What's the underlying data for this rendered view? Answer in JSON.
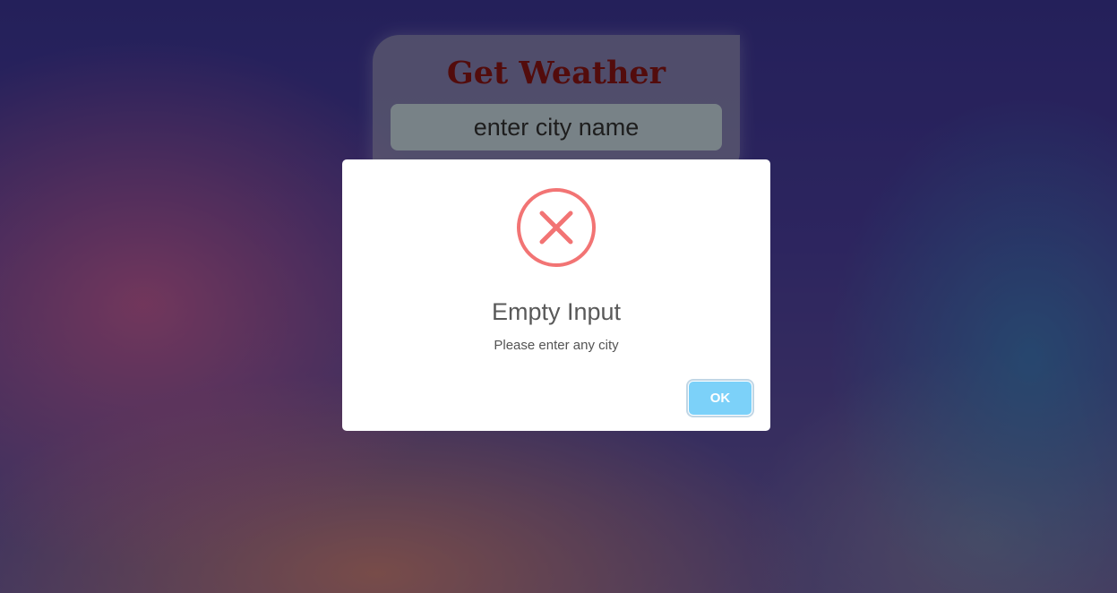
{
  "weather": {
    "title": "Get Weather",
    "input_placeholder": "enter city name",
    "input_value": ""
  },
  "dialog": {
    "icon": "error-x-icon",
    "title": "Empty Input",
    "text": "Please enter any city",
    "ok_label": "OK"
  },
  "colors": {
    "title_color": "#8a1414",
    "error_icon": "#f27474",
    "ok_button": "#7cd1f9"
  }
}
